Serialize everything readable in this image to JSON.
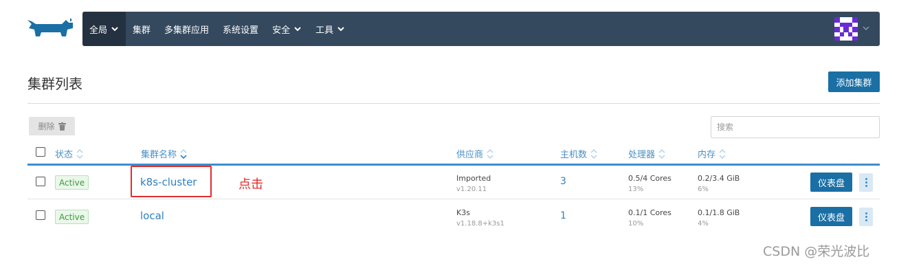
{
  "nav": {
    "items": [
      {
        "label": "全局",
        "dropdown": true,
        "active": true
      },
      {
        "label": "集群",
        "dropdown": false
      },
      {
        "label": "多集群应用",
        "dropdown": false
      },
      {
        "label": "系统设置",
        "dropdown": false
      },
      {
        "label": "安全",
        "dropdown": true
      },
      {
        "label": "工具",
        "dropdown": true
      }
    ]
  },
  "page": {
    "title": "集群列表",
    "add_cluster_label": "添加集群",
    "delete_label": "删除",
    "search_placeholder": "搜索"
  },
  "table": {
    "headers": [
      "状态",
      "集群名称",
      "供应商",
      "主机数",
      "处理器",
      "内存"
    ],
    "rows": [
      {
        "status": "Active",
        "name": "k8s-cluster",
        "provider": "Imported",
        "version": "v1.20.11",
        "hosts": "3",
        "cpu": "0.5/4 Cores",
        "cpu_pct": "13%",
        "mem": "0.2/3.4 GiB",
        "mem_pct": "6%",
        "dashboard_label": "仪表盘"
      },
      {
        "status": "Active",
        "name": "local",
        "provider": "K3s",
        "version": "v1.18.8+k3s1",
        "hosts": "1",
        "cpu": "0.1/1 Cores",
        "cpu_pct": "10%",
        "mem": "0.1/1.8 GiB",
        "mem_pct": "4%",
        "dashboard_label": "仪表盘"
      }
    ]
  },
  "annotation": {
    "text": "点击"
  },
  "watermark": "CSDN @荣光波比",
  "colors": {
    "navbar": "#34495e",
    "primary": "#1a6fa5",
    "link": "#2f80c0",
    "annotation": "#e02b2b",
    "active_badge": "#3d9a3d"
  }
}
